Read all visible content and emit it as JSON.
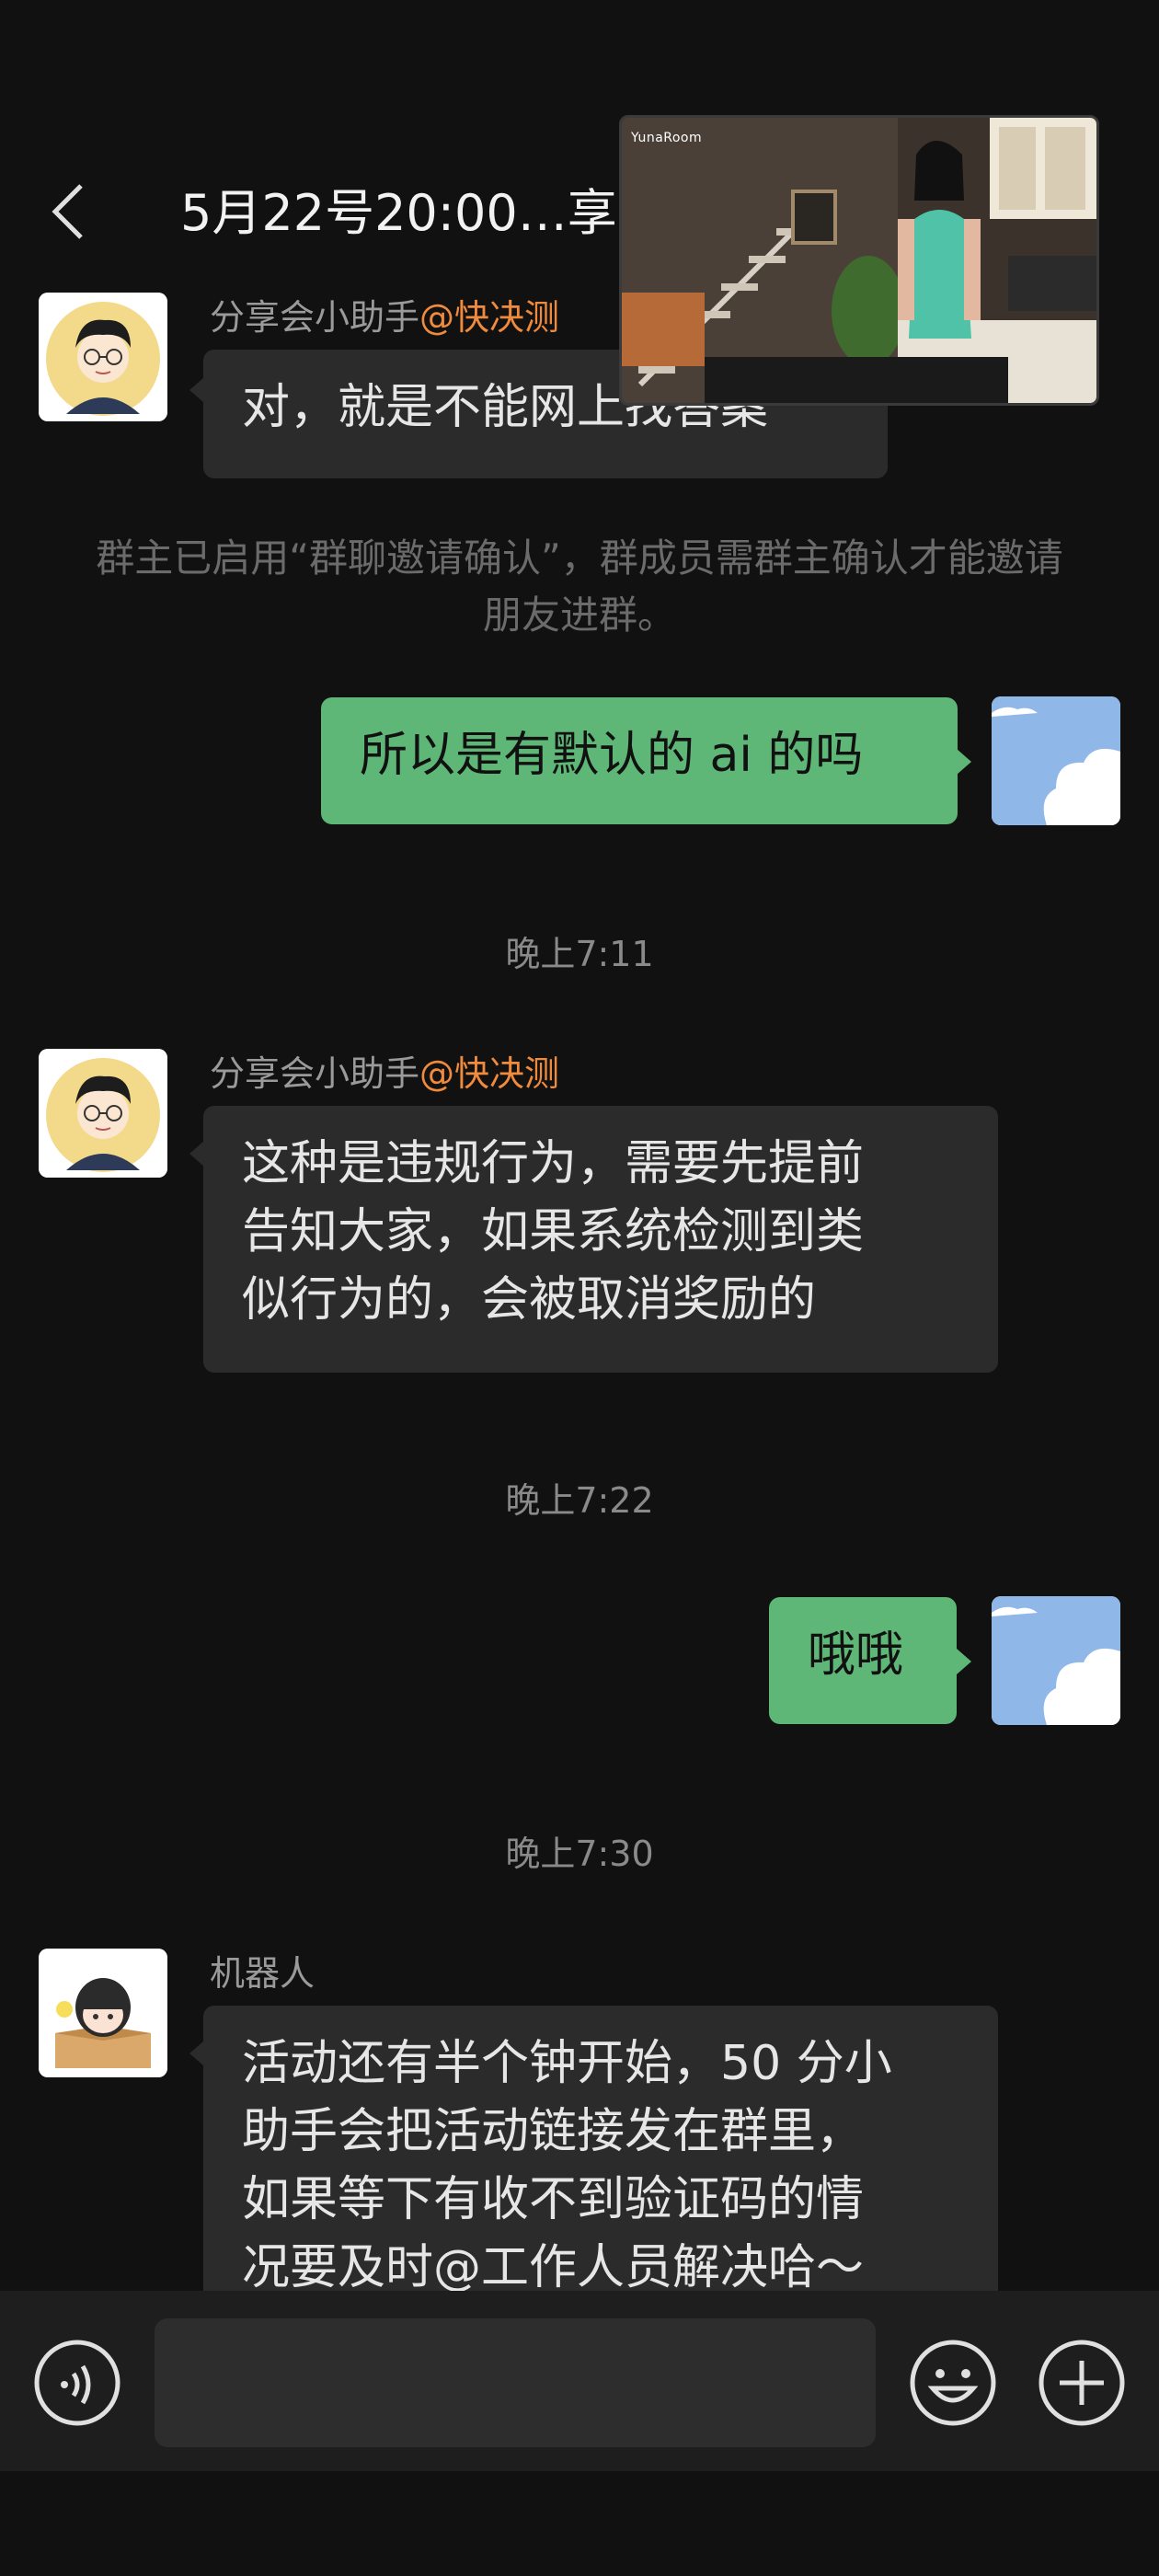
{
  "header": {
    "title": "5月22号20:00…享",
    "back_icon": "chevron-left-icon"
  },
  "video_overlay": {
    "watermark": "YunaRoom"
  },
  "messages": [
    {
      "sender": "分享会小助手",
      "mention": "@快决测",
      "text": "对，就是不能网上找答案"
    },
    {
      "system": "群主已启用“群聊邀请确认”，群成员需群主确认才能邀请朋友进群。"
    },
    {
      "me": true,
      "text": "所以是有默认的 ai 的吗"
    },
    {
      "timestamp": "晚上7:11"
    },
    {
      "sender": "分享会小助手",
      "mention": "@快决测",
      "text_lines": [
        "这种是违规行为，需要先提前",
        "告知大家，如果系统检测到类",
        "似行为的，会被取消奖励的"
      ]
    },
    {
      "timestamp": "晚上7:22"
    },
    {
      "me": true,
      "text": "哦哦"
    },
    {
      "timestamp": "晚上7:30"
    },
    {
      "sender": "机器人",
      "text_lines": [
        "活动还有半个钟开始，50 分小",
        "助手会把活动链接发在群里，",
        "如果等下有收不到验证码的情",
        "况要及时@工作人员解决哈～"
      ]
    }
  ],
  "input_bar": {
    "voice_icon": "voice-icon",
    "input_value": "",
    "emoji_icon": "emoji-icon",
    "plus_icon": "plus-icon"
  },
  "colors": {
    "background": "#111111",
    "my_bubble": "#5fb777",
    "other_bubble": "#2b2b2b",
    "mention": "#f08a3c"
  }
}
